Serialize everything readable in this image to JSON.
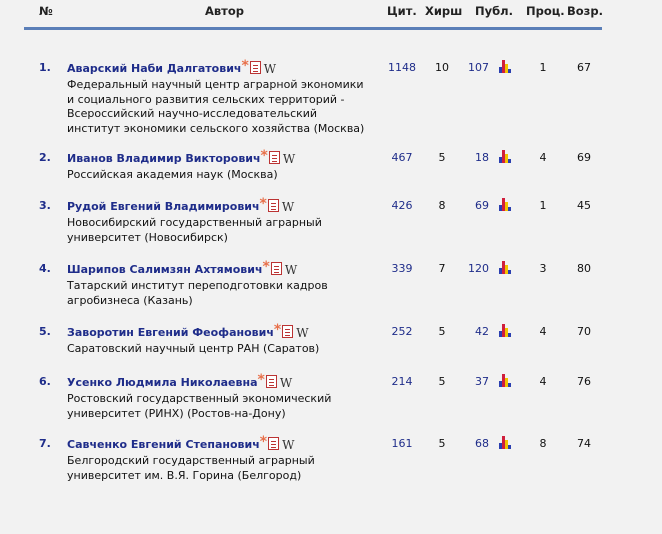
{
  "header": {
    "num": "№",
    "author": "Автор",
    "cit": "Цит.",
    "hirsch": "Хирш",
    "publ": "Публ.",
    "proc": "Проц.",
    "age": "Возр."
  },
  "icons": {
    "star": "asterisk",
    "pdf": "pdf-document-icon",
    "wiki": "W",
    "chart": "bar-chart-icon"
  },
  "colors": {
    "link": "#1f2d8a",
    "rule": "#5b7fb8",
    "star": "#e8704a"
  },
  "rows": [
    {
      "num": "1.",
      "name": "Аварский Наби Далгатович",
      "org": "Федеральный научный центр аграрной экономики и социального развития сельских территорий - Всероссийский научно-исследовательский институт экономики сельского хозяйства (Москва)",
      "cit": "1148",
      "h": "10",
      "pub": "107",
      "proc": "1",
      "age": "67"
    },
    {
      "num": "2.",
      "name": "Иванов Владимир Викторович",
      "org": "Российская академия наук (Москва)",
      "cit": "467",
      "h": "5",
      "pub": "18",
      "proc": "4",
      "age": "69"
    },
    {
      "num": "3.",
      "name": "Рудой Евгений Владимирович",
      "org": "Новосибирский государственный аграрный университет (Новосибирск)",
      "cit": "426",
      "h": "8",
      "pub": "69",
      "proc": "1",
      "age": "45"
    },
    {
      "num": "4.",
      "name": "Шарипов Салимзян Ахтямович",
      "org": "Татарский институт переподготовки кадров агробизнеса (Казань)",
      "cit": "339",
      "h": "7",
      "pub": "120",
      "proc": "3",
      "age": "80"
    },
    {
      "num": "5.",
      "name": "Заворотин Евгений Феофанович",
      "org": "Саратовский научный центр РАН (Саратов)",
      "cit": "252",
      "h": "5",
      "pub": "42",
      "proc": "4",
      "age": "70"
    },
    {
      "num": "6.",
      "name": "Усенко Людмила Николаевна",
      "org": "Ростовский государственный экономический университет (РИНХ) (Ростов-на-Дону)",
      "cit": "214",
      "h": "5",
      "pub": "37",
      "proc": "4",
      "age": "76"
    },
    {
      "num": "7.",
      "name": "Савченко Евгений Степанович",
      "org": "Белгородский государственный аграрный университет им. В.Я. Горина (Белгород)",
      "cit": "161",
      "h": "5",
      "pub": "68",
      "proc": "8",
      "age": "74"
    }
  ]
}
